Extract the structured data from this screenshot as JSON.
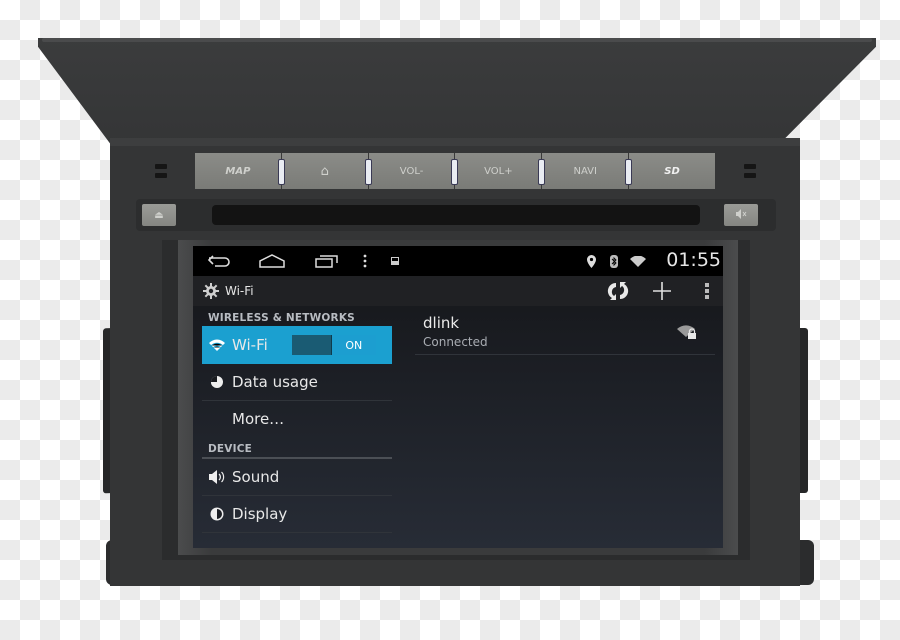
{
  "hardware": {
    "buttons": [
      {
        "id": "map",
        "label": "MAP"
      },
      {
        "id": "home",
        "label": "⌂"
      },
      {
        "id": "vol-down",
        "label": "VOL-"
      },
      {
        "id": "vol-up",
        "label": "VOL+"
      },
      {
        "id": "navi",
        "label": "NAVI"
      },
      {
        "id": "sd",
        "label": "SD"
      }
    ],
    "eject_label": "⏏",
    "mute_label": "🔇"
  },
  "statusbar": {
    "time": "01:55",
    "icons": [
      "back-icon",
      "home-icon",
      "recent-apps-icon",
      "overflow-menu-icon",
      "screenshot-icon",
      "location-icon",
      "bluetooth-icon",
      "wifi-signal-icon"
    ]
  },
  "actionbar": {
    "title": "Wi-Fi",
    "actions": [
      "wps-icon",
      "add-network-icon",
      "overflow-menu-icon"
    ]
  },
  "settings": {
    "wireless_header": "WIRELESS & NETWORKS",
    "wifi_label": "Wi-Fi",
    "wifi_toggle": "ON",
    "data_usage_label": "Data usage",
    "more_label": "More…",
    "device_header": "DEVICE",
    "sound_label": "Sound",
    "display_label": "Display"
  },
  "networks": [
    {
      "name": "dlink",
      "status": "Connected",
      "secured": true
    }
  ],
  "colors": {
    "accent": "#1ba0d0",
    "toggle_track": "#1a5b73"
  }
}
